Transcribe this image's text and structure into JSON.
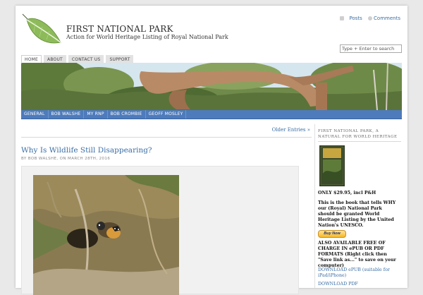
{
  "header": {
    "site_title": "FIRST NATIONAL PARK",
    "tagline": "Action for World Heritage Listing of Royal National Park",
    "feeds": {
      "posts_label": "Posts",
      "comments_label": "Comments"
    },
    "search": {
      "placeholder": "Type + Enter to search",
      "value": ""
    },
    "top_nav": [
      {
        "label": "HOME",
        "active": true
      },
      {
        "label": "ABOUT",
        "active": false
      },
      {
        "label": "CONTACT US",
        "active": false
      },
      {
        "label": "SUPPORT",
        "active": false
      }
    ]
  },
  "category_nav": [
    {
      "label": "GENERAL"
    },
    {
      "label": "BOB WALSHE"
    },
    {
      "label": "MY RNP"
    },
    {
      "label": "BOB CROMBIE"
    },
    {
      "label": "GEOFF MOSLEY"
    }
  ],
  "main": {
    "older_entries": "Older Entries »",
    "post": {
      "title": "Why Is Wildlife Still Disappearing?",
      "meta": "BY BOB WALSHE, ON MARCH 28TH, 2016"
    }
  },
  "sidebar": {
    "widget_title": "FIRST NATIONAL PARK, A NATURAL FOR WORLD HERITAGE",
    "book_cover_text": "A Natural for World Heritage",
    "price": "ONLY $29.95, incl P&H",
    "description": "This is the book that tells WHY our (Royal) National Park should be granted World Heritage Listing by the United Nation's UNESCO.",
    "buy_button": "Buy Now",
    "free_text": "ALSO AVAILABLE FREE OF CHARGE IN ePUB OR PDF FORMATS (Right click then \"Save link as...\" to save on your computer)",
    "download_epub": "DOWNLOAD ePUB (suitable for iPad/iPhone)",
    "download_pdf": "DOWNLOAD PDF"
  },
  "colors": {
    "link": "#3a6ea5",
    "nav_bar": "#4e7bbc",
    "page_bg": "#e9e9e9"
  }
}
